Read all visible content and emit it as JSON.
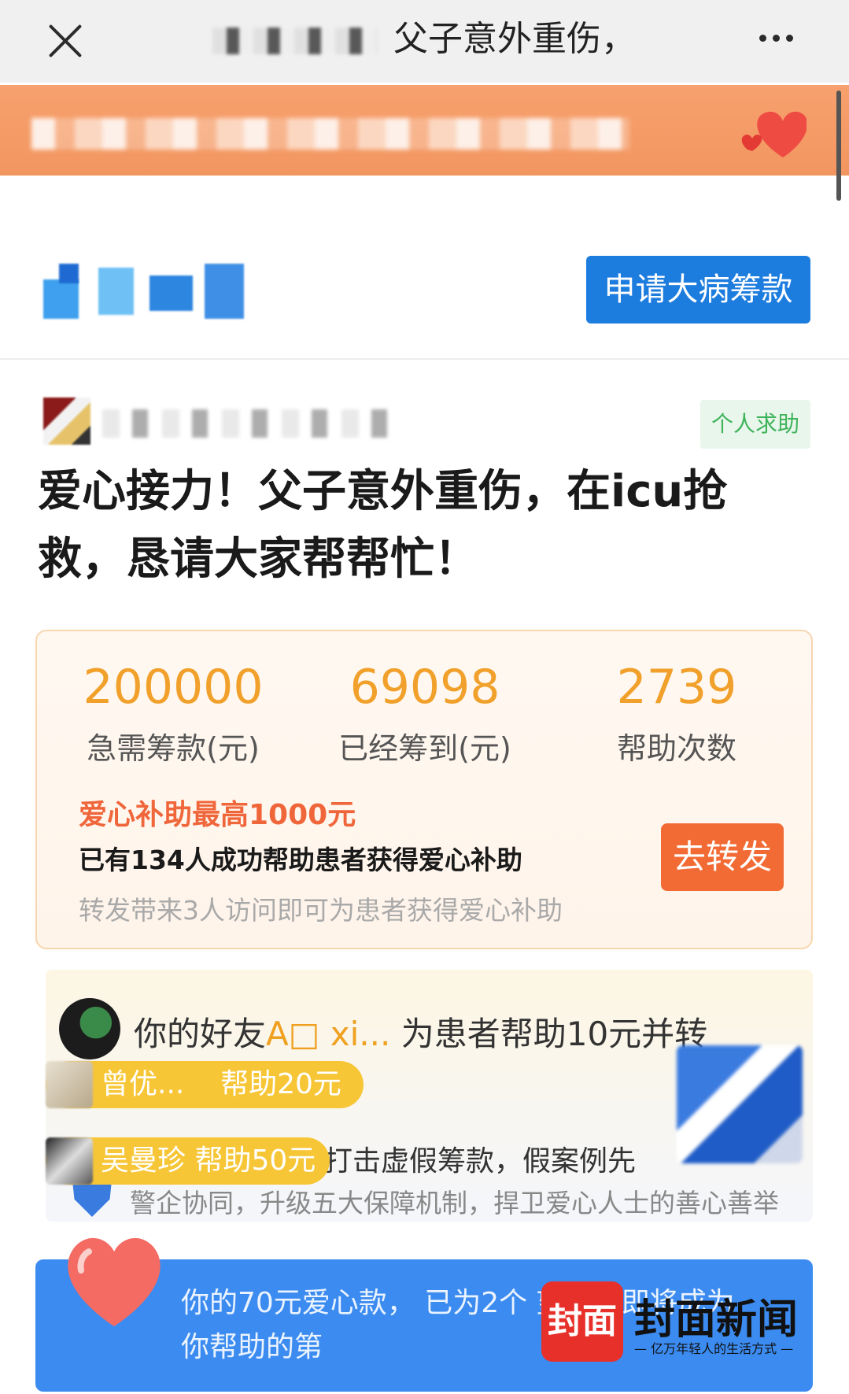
{
  "nav": {
    "title": "父子意外重伤，",
    "close_icon": "close-icon",
    "more_icon": "more-dots-icon"
  },
  "header": {
    "apply_button": "申请大病筹款"
  },
  "publisher": {
    "tag": "个人求助"
  },
  "campaign": {
    "title": "爱心接力！父子意外重伤，在icu抢救，恳请大家帮帮忙！"
  },
  "stats": [
    {
      "value": "200000",
      "label": "急需筹款(元)"
    },
    {
      "value": "69098",
      "label": "已经筹到(元)"
    },
    {
      "value": "2739",
      "label": "帮助次数"
    }
  ],
  "subsidy": {
    "title": "爱心补助最高1000元",
    "line": "已有134人成功帮助患者获得爱心补助",
    "hint": "转发带来3人访问即可为患者获得爱心补助",
    "share_button": "去转发"
  },
  "activity": {
    "friend_prefix": "你的好友",
    "friend_name": "A□ xi...",
    "friend_action": "为患者帮助10元并转",
    "donors": [
      {
        "name": "曾优...",
        "amount": "帮助20元"
      },
      {
        "name": "吴曼珍",
        "amount": "帮助50元"
      }
    ],
    "news_title": "打击虚假筹款，假案例先",
    "news_desc": "警企协同，升级五大保障机制，捍卫爱心人士的善心善举"
  },
  "bottom": {
    "text": "你的70元爱心款， 已为2个 望，这即将成为你帮助的第"
  },
  "watermark": {
    "badge": "封面",
    "name": "封面新闻",
    "slogan": "— 亿万年轻人的生活方式 —"
  },
  "colors": {
    "accent_orange": "#f1a12b",
    "share_button": "#f26b35",
    "banner": "#f29660",
    "primary_blue": "#1d7ddf",
    "tag_green": "#3fb35a"
  }
}
